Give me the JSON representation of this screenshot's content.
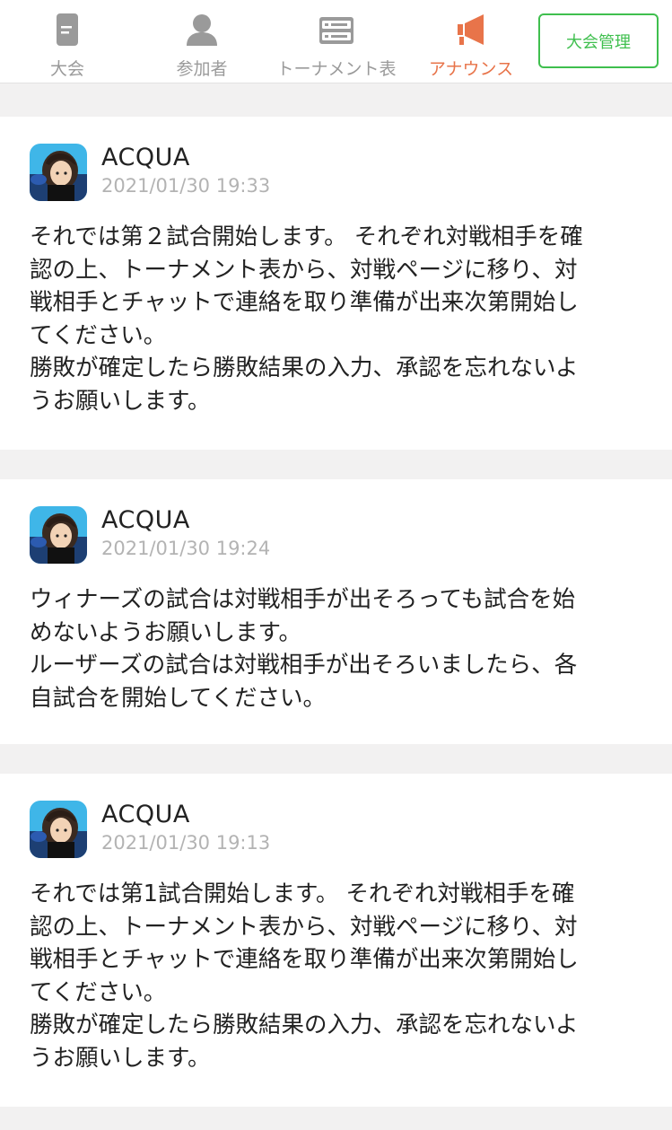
{
  "nav": {
    "tabs": [
      {
        "label": "大会",
        "icon": "document-icon"
      },
      {
        "label": "参加者",
        "icon": "person-icon"
      },
      {
        "label": "トーナメント表",
        "icon": "bracket-list-icon"
      },
      {
        "label": "アナウンス",
        "icon": "megaphone-icon",
        "active": true
      }
    ],
    "manage_button": "大会管理"
  },
  "colors": {
    "accent_orange": "#e8744a",
    "accent_green": "#3fbf4e",
    "inactive_gray": "#9a9a9a",
    "timestamp_gray": "#b3b3b3",
    "background": "#f2f1f1"
  },
  "announcements": [
    {
      "author": "ACQUA",
      "timestamp": "2021/01/30 19:33",
      "body": "それでは第２試合開始します。 それぞれ対戦相手を確\n認の上、トーナメント表から、対戦ページに移り、対\n戦相手とチャットで連絡を取り準備が出来次第開始し\nてください。\n勝敗が確定したら勝敗結果の入力、承認を忘れないよ\nうお願いします。"
    },
    {
      "author": "ACQUA",
      "timestamp": "2021/01/30 19:24",
      "body": "ウィナーズの試合は対戦相手が出そろっても試合を始\nめないようお願いします。\nルーザーズの試合は対戦相手が出そろいましたら、各\n自試合を開始してください。"
    },
    {
      "author": "ACQUA",
      "timestamp": "2021/01/30 19:13",
      "body": "それでは第1試合開始します。 それぞれ対戦相手を確\n認の上、トーナメント表から、対戦ページに移り、対\n戦相手とチャットで連絡を取り準備が出来次第開始し\nてください。\n勝敗が確定したら勝敗結果の入力、承認を忘れないよ\nうお願いします。"
    }
  ]
}
